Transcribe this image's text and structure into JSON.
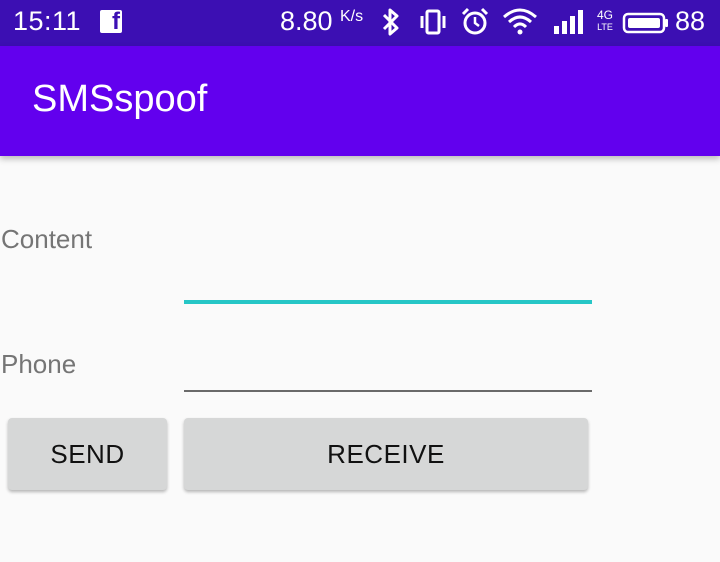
{
  "status_bar": {
    "time": "15:11",
    "notification_icon": "facebook-icon",
    "net_speed": "8.80",
    "net_speed_unit": "K/s",
    "icons": [
      "bluetooth-icon",
      "vibrate-icon",
      "alarm-icon",
      "wifi-icon",
      "signal-icon",
      "lte-icon",
      "battery-icon"
    ],
    "lte_top": "4G",
    "lte_bottom": "LTE",
    "battery_level": "88"
  },
  "app_bar": {
    "title": "SMSspoof",
    "color": "#6200ee"
  },
  "form": {
    "content_label": "Content",
    "content_value": "",
    "phone_label": "Phone",
    "phone_value": ""
  },
  "buttons": {
    "send": "SEND",
    "receive": "RECEIVE"
  },
  "colors": {
    "status_bar": "#3c0fb3",
    "accent": "#26c6c6",
    "button": "#d6d7d7"
  }
}
